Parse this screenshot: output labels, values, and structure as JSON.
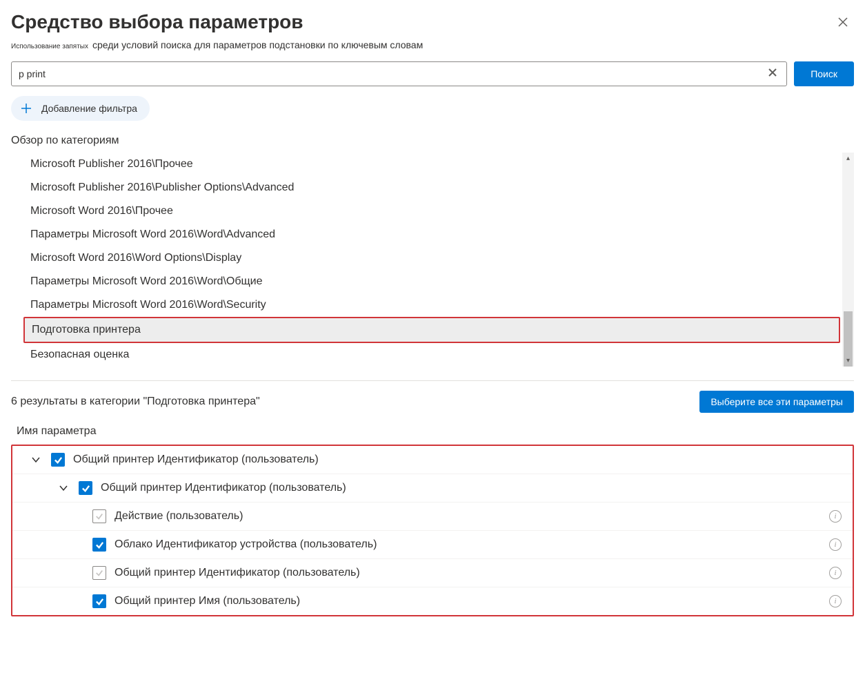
{
  "header": {
    "title": "Средство выбора параметров",
    "subtitle_prefix": "Использование запятых",
    "subtitle_rest": "среди условий поиска для параметров подстановки по ключевым словам"
  },
  "search": {
    "value": "p print",
    "button_label": "Поиск"
  },
  "add_filter_label": "Добавление фильтра",
  "browse_label": "Обзор по категориям",
  "categories": [
    {
      "label": "Microsoft Publisher 2016\\Прочее",
      "selected": false
    },
    {
      "label": "Microsoft Publisher 2016\\Publisher Options\\Advanced",
      "selected": false
    },
    {
      "label": "Microsoft Word 2016\\Прочее",
      "selected": false
    },
    {
      "label": "Параметры Microsoft Word 2016\\Word\\Advanced",
      "selected": false
    },
    {
      "label": "Microsoft Word 2016\\Word Options\\Display",
      "selected": false
    },
    {
      "label": "Параметры Microsoft Word 2016\\Word\\Общие",
      "selected": false
    },
    {
      "label": "Параметры Microsoft Word 2016\\Word\\Security",
      "selected": false
    },
    {
      "label": "Подготовка принтера",
      "selected": true
    },
    {
      "label": "Безопасная оценка",
      "selected": false
    }
  ],
  "results": {
    "count_text": "6 результаты в категории \"Подготовка принтера\"",
    "select_all_label": "Выберите все эти параметры",
    "column_header": "Имя параметра"
  },
  "tree": [
    {
      "indent": 0,
      "chevron": true,
      "checked": true,
      "label": "Общий принтер  Идентификатор (пользователь)",
      "info": false
    },
    {
      "indent": 1,
      "chevron": true,
      "checked": true,
      "label": "Общий принтер  Идентификатор (пользователь)",
      "info": false
    },
    {
      "indent": 2,
      "chevron": false,
      "checked": false,
      "label": "Действие (пользователь)",
      "info": true
    },
    {
      "indent": 2,
      "chevron": false,
      "checked": true,
      "label": "Облако  Идентификатор устройства (пользователь)",
      "info": true
    },
    {
      "indent": 2,
      "chevron": false,
      "checked": false,
      "label": "Общий принтер  Идентификатор (пользователь)",
      "info": true
    },
    {
      "indent": 2,
      "chevron": false,
      "checked": true,
      "label": "Общий принтер  Имя (пользователь)",
      "info": true
    }
  ]
}
